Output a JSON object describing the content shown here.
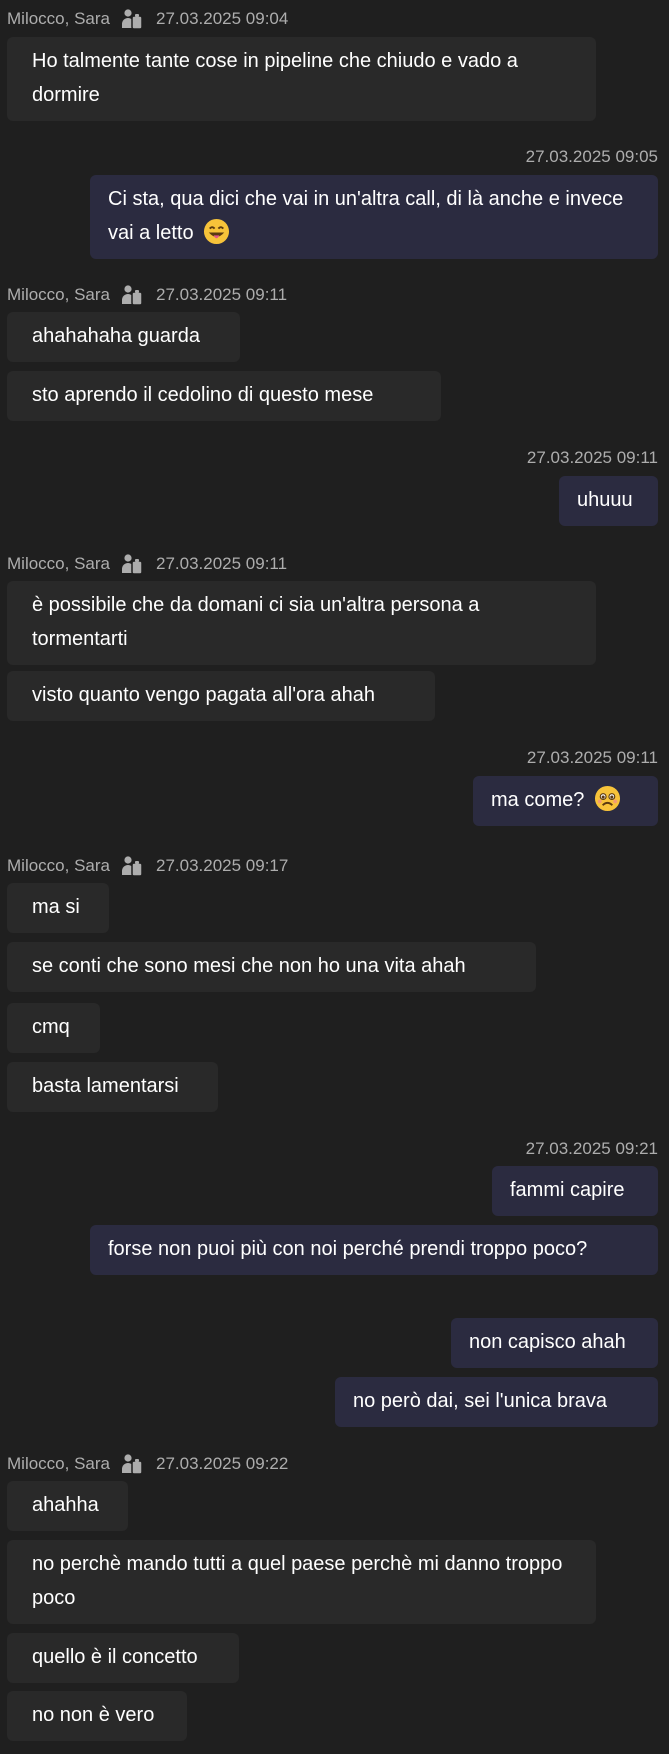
{
  "messages": [
    {
      "type": "meta",
      "sender": "Milocco, Sara",
      "time": "27.03.2025 09:04"
    },
    {
      "type": "in",
      "text": "Ho talmente tante cose in pipeline che chiudo e vado a dormire"
    },
    {
      "type": "meta-out",
      "time": "27.03.2025 09:05"
    },
    {
      "type": "out",
      "text": "Ci sta, qua dici che vai in un'altra call, di là anche e invece vai a letto",
      "emoji": "grinning-tongue-emoji"
    },
    {
      "type": "meta",
      "sender": "Milocco, Sara",
      "time": "27.03.2025 09:11"
    },
    {
      "type": "in",
      "text": "ahahahaha guarda"
    },
    {
      "type": "in",
      "text": "sto aprendo il cedolino di questo mese"
    },
    {
      "type": "meta-out",
      "time": "27.03.2025 09:11"
    },
    {
      "type": "out",
      "text": "uhuuu"
    },
    {
      "type": "meta",
      "sender": "Milocco, Sara",
      "time": "27.03.2025 09:11"
    },
    {
      "type": "in",
      "text": "è possibile che da domani ci sia un'altra persona a tormentarti"
    },
    {
      "type": "in",
      "text": "visto quanto vengo pagata all'ora ahah"
    },
    {
      "type": "meta-out",
      "time": "27.03.2025 09:11"
    },
    {
      "type": "out",
      "text": "ma come?",
      "emoji": "frowning-emoji"
    },
    {
      "type": "meta",
      "sender": "Milocco, Sara",
      "time": "27.03.2025 09:17"
    },
    {
      "type": "in",
      "text": "ma si"
    },
    {
      "type": "in",
      "text": "se conti che sono mesi che non ho una vita ahah"
    },
    {
      "type": "in",
      "text": "cmq"
    },
    {
      "type": "in",
      "text": "basta lamentarsi"
    },
    {
      "type": "meta-out",
      "time": "27.03.2025 09:21"
    },
    {
      "type": "out",
      "text": "fammi capire"
    },
    {
      "type": "out",
      "text": "forse non puoi più con noi perché prendi troppo poco?"
    },
    {
      "type": "out",
      "text": "non capisco ahah"
    },
    {
      "type": "out",
      "text": "no però dai, sei l'unica brava"
    },
    {
      "type": "meta",
      "sender": "Milocco, Sara",
      "time": "27.03.2025 09:22"
    },
    {
      "type": "in",
      "text": "ahahha"
    },
    {
      "type": "in",
      "text": "no perchè mando tutti a quel paese perchè mi danno troppo poco"
    },
    {
      "type": "in",
      "text": "quello è il concetto"
    },
    {
      "type": "in",
      "text": "no non è vero"
    }
  ],
  "icons": {
    "presence": "status-icon"
  },
  "colors": {
    "background": "#1f1f1f",
    "incoming_bubble": "#292929",
    "outgoing_bubble": "#2b2b40",
    "meta_text": "#adadad"
  }
}
